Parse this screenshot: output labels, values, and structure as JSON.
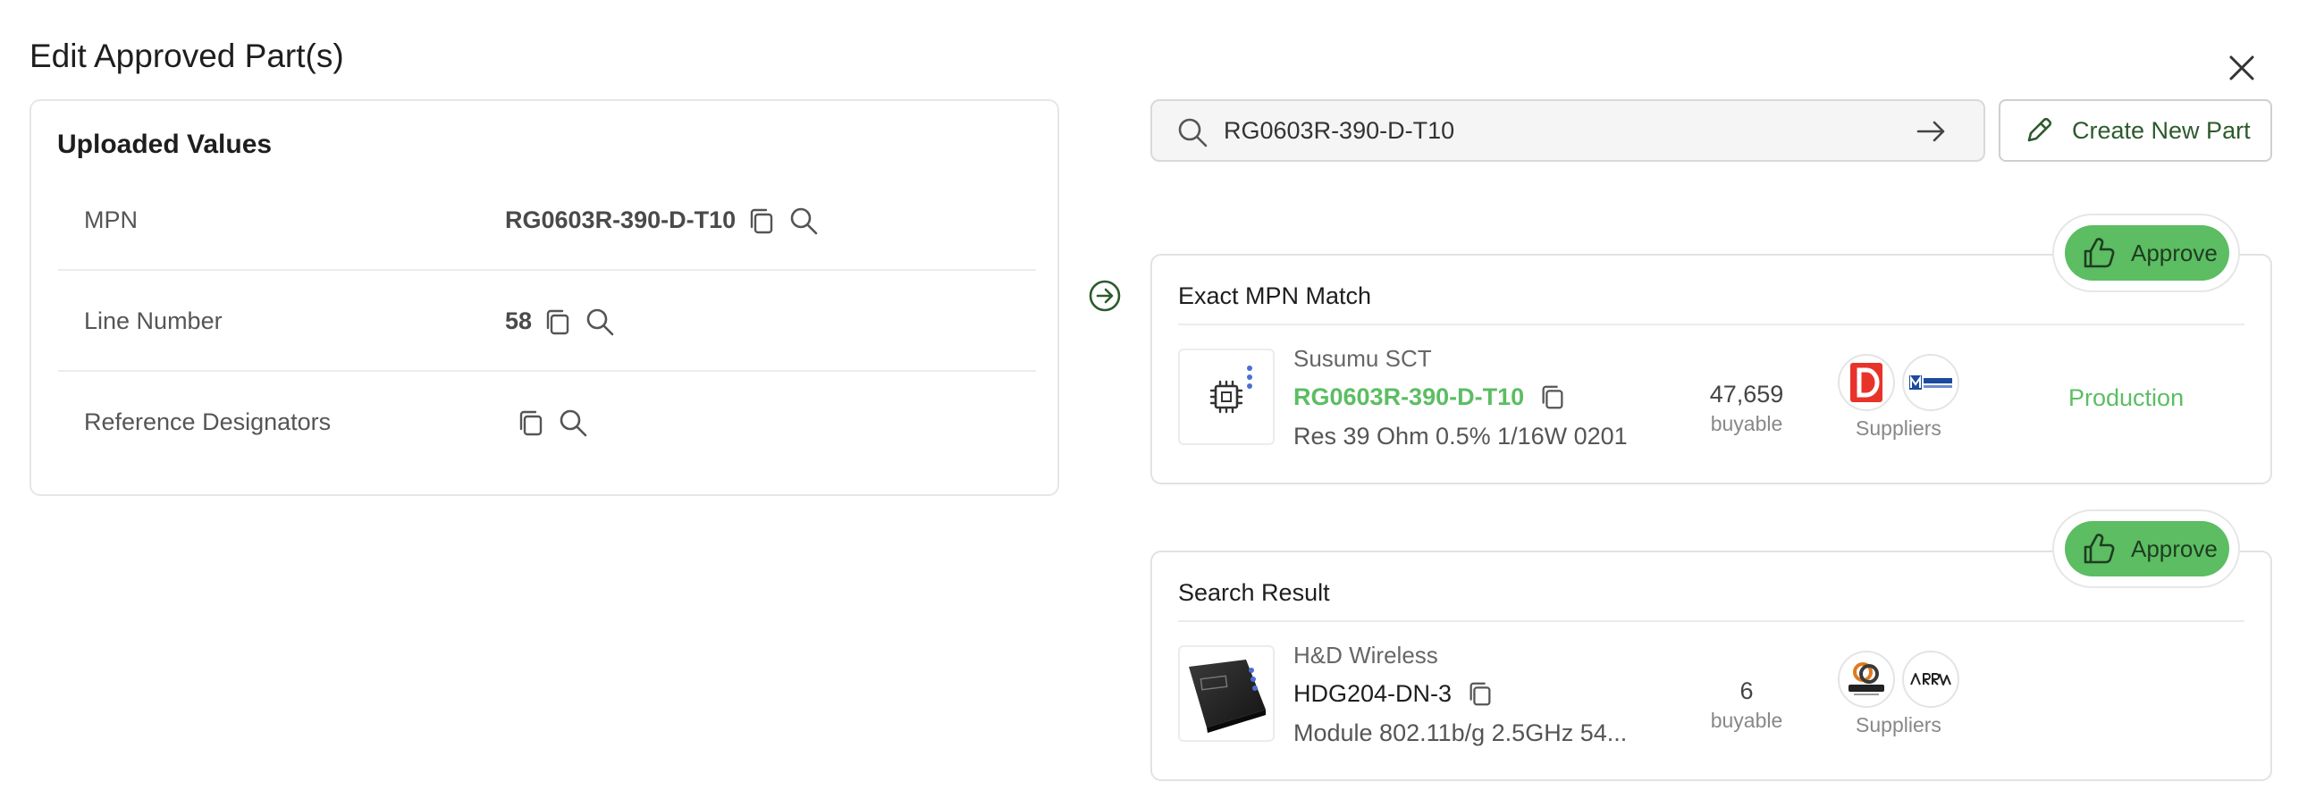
{
  "dialog": {
    "title": "Edit Approved Part(s)"
  },
  "uploaded": {
    "title": "Uploaded Values",
    "rows": [
      {
        "label": "MPN",
        "value": "RG0603R-390-D-T10"
      },
      {
        "label": "Line Number",
        "value": "58"
      },
      {
        "label": "Reference Designators",
        "value": ""
      }
    ]
  },
  "search": {
    "value": "RG0603R-390-D-T10",
    "placeholder": ""
  },
  "create_button": {
    "label": "Create New Part"
  },
  "results": [
    {
      "section_title": "Exact MPN Match",
      "approve_label": "Approve",
      "manufacturer": "Susumu SCT",
      "mpn": "RG0603R-390-D-T10",
      "description": "Res 39 Ohm 0.5% 1/16W 0201",
      "quantity": "47,659",
      "quantity_label": "buyable",
      "suppliers_label": "Suppliers",
      "supplier_logos": [
        "digikey-logo",
        "mouser-logo"
      ],
      "status": "Production"
    },
    {
      "section_title": "Search Result",
      "approve_label": "Approve",
      "manufacturer": "H&D Wireless",
      "mpn": "HDG204-DN-3",
      "description": "Module 802.11b/g 2.5GHz 54...",
      "quantity": "6",
      "quantity_label": "buyable",
      "suppliers_label": "Suppliers",
      "supplier_logos": [
        "verical-logo",
        "arrow-logo"
      ],
      "status": ""
    }
  ],
  "colors": {
    "accent_green": "#5cbd63",
    "border": "#e2e2e2",
    "text_dark": "#1e1e1e"
  }
}
